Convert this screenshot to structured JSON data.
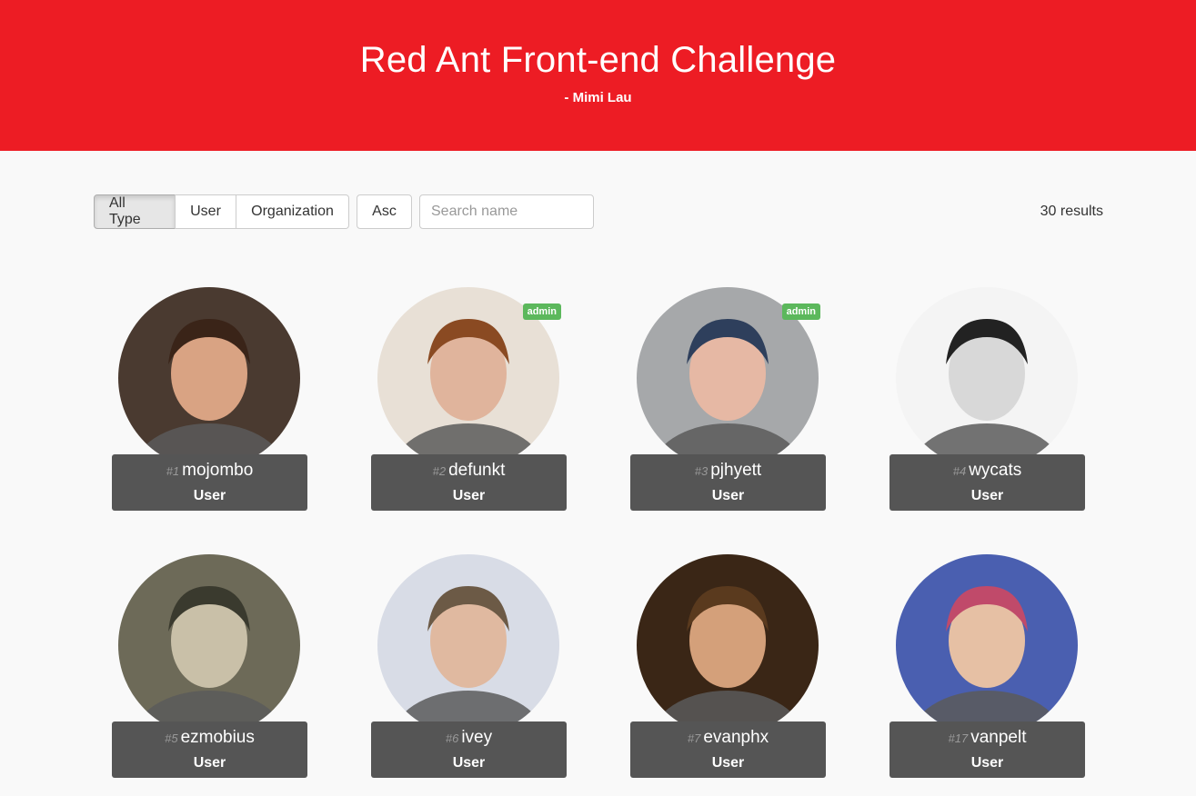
{
  "header": {
    "title": "Red Ant Front-end Challenge",
    "subtitle": "- Mimi Lau",
    "background": "#ed1c24"
  },
  "toolbar": {
    "type_filters": [
      "All Type",
      "User",
      "Organization"
    ],
    "active_filter": "All Type",
    "sort_label": "Asc",
    "search_placeholder": "Search name",
    "search_value": "",
    "results_text": "30 results"
  },
  "cards": [
    {
      "num": "#1",
      "login": "mojombo",
      "type": "User",
      "badge": "",
      "avatar_bg": "#4a3a30",
      "skin": "#d9a383",
      "hair": "#3a2418"
    },
    {
      "num": "#2",
      "login": "defunkt",
      "type": "User",
      "badge": "admin",
      "avatar_bg": "#e8e0d6",
      "skin": "#e0b49c",
      "hair": "#8a4a22"
    },
    {
      "num": "#3",
      "login": "pjhyett",
      "type": "User",
      "badge": "admin",
      "avatar_bg": "#a6a8aa",
      "skin": "#e6b8a4",
      "hair": "#2e3f5c"
    },
    {
      "num": "#4",
      "login": "wycats",
      "type": "User",
      "badge": "",
      "avatar_bg": "#f4f4f4",
      "skin": "#d8d8d8",
      "hair": "#222222"
    },
    {
      "num": "#5",
      "login": "ezmobius",
      "type": "User",
      "badge": "",
      "avatar_bg": "#6d6a58",
      "skin": "#c9c0a8",
      "hair": "#3a3a2e"
    },
    {
      "num": "#6",
      "login": "ivey",
      "type": "User",
      "badge": "",
      "avatar_bg": "#d8dce6",
      "skin": "#e0b9a0",
      "hair": "#6c5a46"
    },
    {
      "num": "#7",
      "login": "evanphx",
      "type": "User",
      "badge": "",
      "avatar_bg": "#3a2616",
      "skin": "#d4a07a",
      "hair": "#5a3a1e"
    },
    {
      "num": "#17",
      "login": "vanpelt",
      "type": "User",
      "badge": "",
      "avatar_bg": "#4a5fb0",
      "skin": "#e6c0a4",
      "hair": "#c04a6a"
    }
  ]
}
